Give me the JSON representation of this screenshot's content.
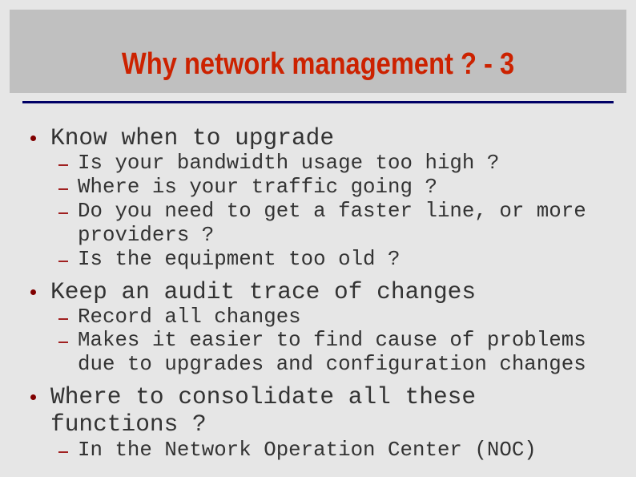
{
  "slide": {
    "title": "Why network management ? - 3",
    "colors": {
      "title": "#cc2200",
      "title_bg": "#c0c0c0",
      "rule": "#000066",
      "bullet": "#800000",
      "text": "#333333",
      "background": "#e6e6e6"
    },
    "bullets": [
      {
        "text": "Know when to upgrade",
        "sub": [
          "Is your bandwidth usage too high ?",
          "Where is your traffic going ?",
          "Do you need to get a faster line, or more providers ?",
          "Is the equipment too old ?"
        ]
      },
      {
        "text": "Keep an audit trace of changes",
        "sub": [
          "Record all changes",
          "Makes it easier to find cause of problems due to upgrades and configuration changes"
        ]
      },
      {
        "text": "Where to consolidate all these functions ?",
        "sub": [
          "In the Network Operation Center (NOC)"
        ]
      }
    ],
    "wrapped_lines": {
      "b0s2_a": "Do you need to get a faster line, or more",
      "b0s2_b": "providers ?",
      "b1s1_a": "Makes it easier to find cause of problems",
      "b1s1_b": "due to upgrades and configuration changes",
      "b2_a": "Where to consolidate all these",
      "b2_b": "functions ?"
    }
  }
}
